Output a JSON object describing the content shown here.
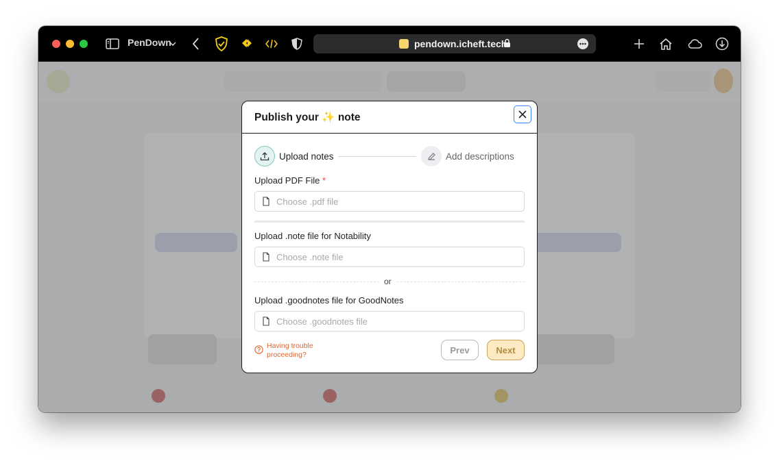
{
  "browser": {
    "profile_name": "PenDown",
    "url": "pendown.icheft.tech",
    "traffic_colors": [
      "#fe5f57",
      "#febc2e",
      "#28c840"
    ],
    "icons": [
      "sidebar-icon",
      "chevron-down-icon",
      "back-icon",
      "shield-check-icon",
      "extension-icon",
      "code-icon",
      "privacy-shield-icon",
      "favicon-icon",
      "lock-icon",
      "more-icon",
      "plus-icon",
      "home-icon",
      "cloud-icon",
      "download-icon"
    ]
  },
  "modal": {
    "title_prefix": "Publish your",
    "title_emoji": "✨",
    "title_suffix": "note",
    "close_icon": "close-icon",
    "steps": [
      {
        "label": "Upload notes",
        "icon": "upload-icon",
        "active": true
      },
      {
        "label": "Add descriptions",
        "icon": "pencil-icon",
        "active": false
      }
    ],
    "pdf": {
      "label": "Upload PDF File",
      "required_mark": "*",
      "placeholder": "Choose .pdf file"
    },
    "note": {
      "label": "Upload .note file for Notability",
      "placeholder": "Choose .note file"
    },
    "or_text": "or",
    "goodnotes": {
      "label": "Upload .goodnotes file for GoodNotes",
      "placeholder": "Choose .goodnotes file"
    },
    "help_text_line1": "Having trouble",
    "help_text_line2": "proceeding?",
    "prev_label": "Prev",
    "next_label": "Next",
    "accent_color": "#3b82f6",
    "help_color": "#e0642e",
    "next_bg": "#fdeac2"
  }
}
